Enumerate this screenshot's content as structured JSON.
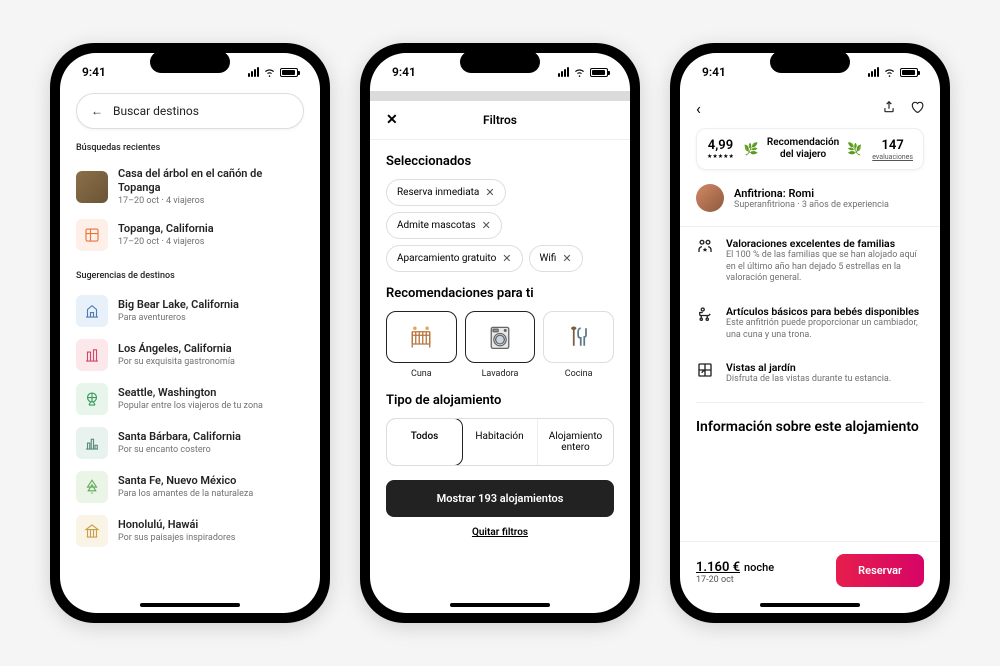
{
  "status": {
    "time": "9:41"
  },
  "phone1": {
    "search_placeholder": "Buscar destinos",
    "recent_label": "Búsquedas recientes",
    "recent": [
      {
        "title": "Casa del árbol en el cañón de Topanga",
        "sub": "17–20 oct · 4 viajeros"
      },
      {
        "title": "Topanga, California",
        "sub": "17–20 oct · 4 viajeros"
      }
    ],
    "suggestions_label": "Sugerencias de destinos",
    "suggestions": [
      {
        "title": "Big Bear Lake, California",
        "sub": "Para aventureros"
      },
      {
        "title": "Los Ángeles, California",
        "sub": "Por su exquisita gastronomía"
      },
      {
        "title": "Seattle, Washington",
        "sub": "Popular entre los viajeros de tu zona"
      },
      {
        "title": "Santa Bárbara, California",
        "sub": "Por su encanto costero"
      },
      {
        "title": "Santa Fe, Nuevo México",
        "sub": "Para los amantes de la naturaleza"
      },
      {
        "title": "Honolulú, Hawái",
        "sub": "Por sus paisajes inspiradores"
      }
    ]
  },
  "phone2": {
    "header": "Filtros",
    "selected_label": "Seleccionados",
    "chips": [
      "Reserva inmediata",
      "Admite mascotas",
      "Aparcamiento gratuito",
      "Wifi"
    ],
    "recs_label": "Recomendaciones para ti",
    "rec_items": [
      "Cuna",
      "Lavadora",
      "Cocina"
    ],
    "type_label": "Tipo de alojamiento",
    "types": [
      "Todos",
      "Habitación",
      "Alojamiento entero"
    ],
    "show_button": "Mostrar 193 alojamientos",
    "clear": "Quitar filtros"
  },
  "phone3": {
    "rating": "4,99",
    "badge": "Recomendación del viajero",
    "review_count": "147",
    "review_label": "evaluaciones",
    "host_label": "Anfitriona: Romi",
    "host_sub": "Superanfitriona · 3 años de experiencia",
    "features": [
      {
        "title": "Valoraciones excelentes de familias",
        "sub": "El 100 % de las familias que se han alojado aquí en el último año han dejado 5 estrellas en la valoración general."
      },
      {
        "title": "Artículos básicos para bebés disponibles",
        "sub": "Este anfitrión puede proporcionar un cambiador, una cuna y una trona."
      },
      {
        "title": "Vistas al jardín",
        "sub": "Disfruta de las vistas durante tu estancia."
      }
    ],
    "info_title": "Información sobre este alojamiento",
    "price": "1.160 €",
    "price_unit": "noche",
    "dates": "17-20 oct",
    "reserve": "Reservar"
  }
}
